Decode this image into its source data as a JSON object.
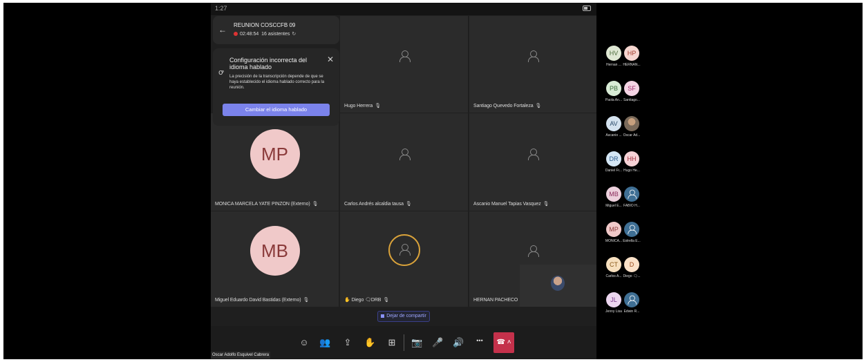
{
  "status": {
    "time": "1:27"
  },
  "meeting": {
    "title": "REUNION COSCCFB 09",
    "duration": "02:48:54",
    "attendees": "16 asistentes"
  },
  "notice": {
    "title": "Configuración incorrecta del idioma hablado",
    "body": "La precisión de la transcripción depende de que se haya establecido el idioma hablado correcto para la reunión.",
    "button": "Cambiar el idioma hablado"
  },
  "tiles": [
    {
      "name": "Hugo Herrera",
      "type": "icon"
    },
    {
      "name": "Santiago Quevedo Fortaleza",
      "type": "icon"
    },
    {
      "name": "MONICA MARCELA YATE PINZON (Externo)",
      "type": "initials",
      "initials": "MP"
    },
    {
      "name": "Carlos Andrés alcaldia tausa",
      "type": "icon"
    },
    {
      "name": "Ascanio Manuel Tapias Vasquez",
      "type": "icon"
    },
    {
      "name": "Miguel Eduardo David Bastidas (Externo)",
      "type": "initials",
      "initials": "MB"
    },
    {
      "name": "Diego 🗨DRB",
      "type": "speaking",
      "hand": "✋"
    },
    {
      "name": "HERNAN PACHECO",
      "type": "icon"
    }
  ],
  "share": {
    "stop_label": "Dejar de compartir"
  },
  "caption": "Oscar Adolfo Esquivel Cabrera",
  "roster": [
    {
      "initials": "HV",
      "name": "Hernan ...",
      "bg": "#dfe8d4",
      "fg": "#4a6a3a"
    },
    {
      "initials": "HP",
      "name": "HERNAN...",
      "bg": "#f6d6d0",
      "fg": "#a03a2a"
    },
    {
      "initials": "PB",
      "name": "Paola An...",
      "bg": "#d9ecd6",
      "fg": "#3a6a3a"
    },
    {
      "initials": "SF",
      "name": "Santiago...",
      "bg": "#f4d4e4",
      "fg": "#a02a6a"
    },
    {
      "initials": "AV",
      "name": "Ascanio ...",
      "bg": "#d4e2ef",
      "fg": "#2a4a6a"
    },
    {
      "initials": "",
      "name": "Oscar Ad...",
      "type": "photo"
    },
    {
      "initials": "DR",
      "name": "Daniel Fr...",
      "bg": "#d4e6f4",
      "fg": "#2a5a8a"
    },
    {
      "initials": "HH",
      "name": "Hugo He...",
      "bg": "#f6d2d6",
      "fg": "#a02a3a"
    },
    {
      "initials": "MB",
      "name": "Miguel E...",
      "bg": "#ecd0dc",
      "fg": "#8a2a5a"
    },
    {
      "initials": "",
      "name": "FABIO H...",
      "type": "icon"
    },
    {
      "initials": "MP",
      "name": "MONICA...",
      "bg": "#f0c9c9",
      "fg": "#8a3a3a"
    },
    {
      "initials": "",
      "name": "Estrella E...",
      "type": "icon"
    },
    {
      "initials": "CT",
      "name": "Carlos A...",
      "bg": "#f7e0bf",
      "fg": "#8a5a1a"
    },
    {
      "initials": "D",
      "name": "Diego 🗨...",
      "bg": "#fbe1c8",
      "fg": "#9a4a1a"
    },
    {
      "initials": "JL",
      "name": "Jenny Lisa",
      "bg": "#ecd6ef",
      "fg": "#7a3a8a"
    },
    {
      "initials": "",
      "name": "Edwin R...",
      "type": "icon"
    }
  ],
  "icons": {
    "back": "←",
    "notice": "ꝍ",
    "close": "✕",
    "mic_off": "🎙",
    "refresh": "↻",
    "chat": "☺",
    "people": "👥",
    "share": "⇪",
    "reactions": "✋",
    "view": "⊞",
    "camera_off": "📷",
    "mic": "🎤",
    "speaker": "🔊",
    "more": "•••",
    "hangup": "☎ ˄"
  },
  "colors": {
    "accent": "#7b83eb",
    "hangup": "#c4314b",
    "speaking": "#d9a23a"
  }
}
